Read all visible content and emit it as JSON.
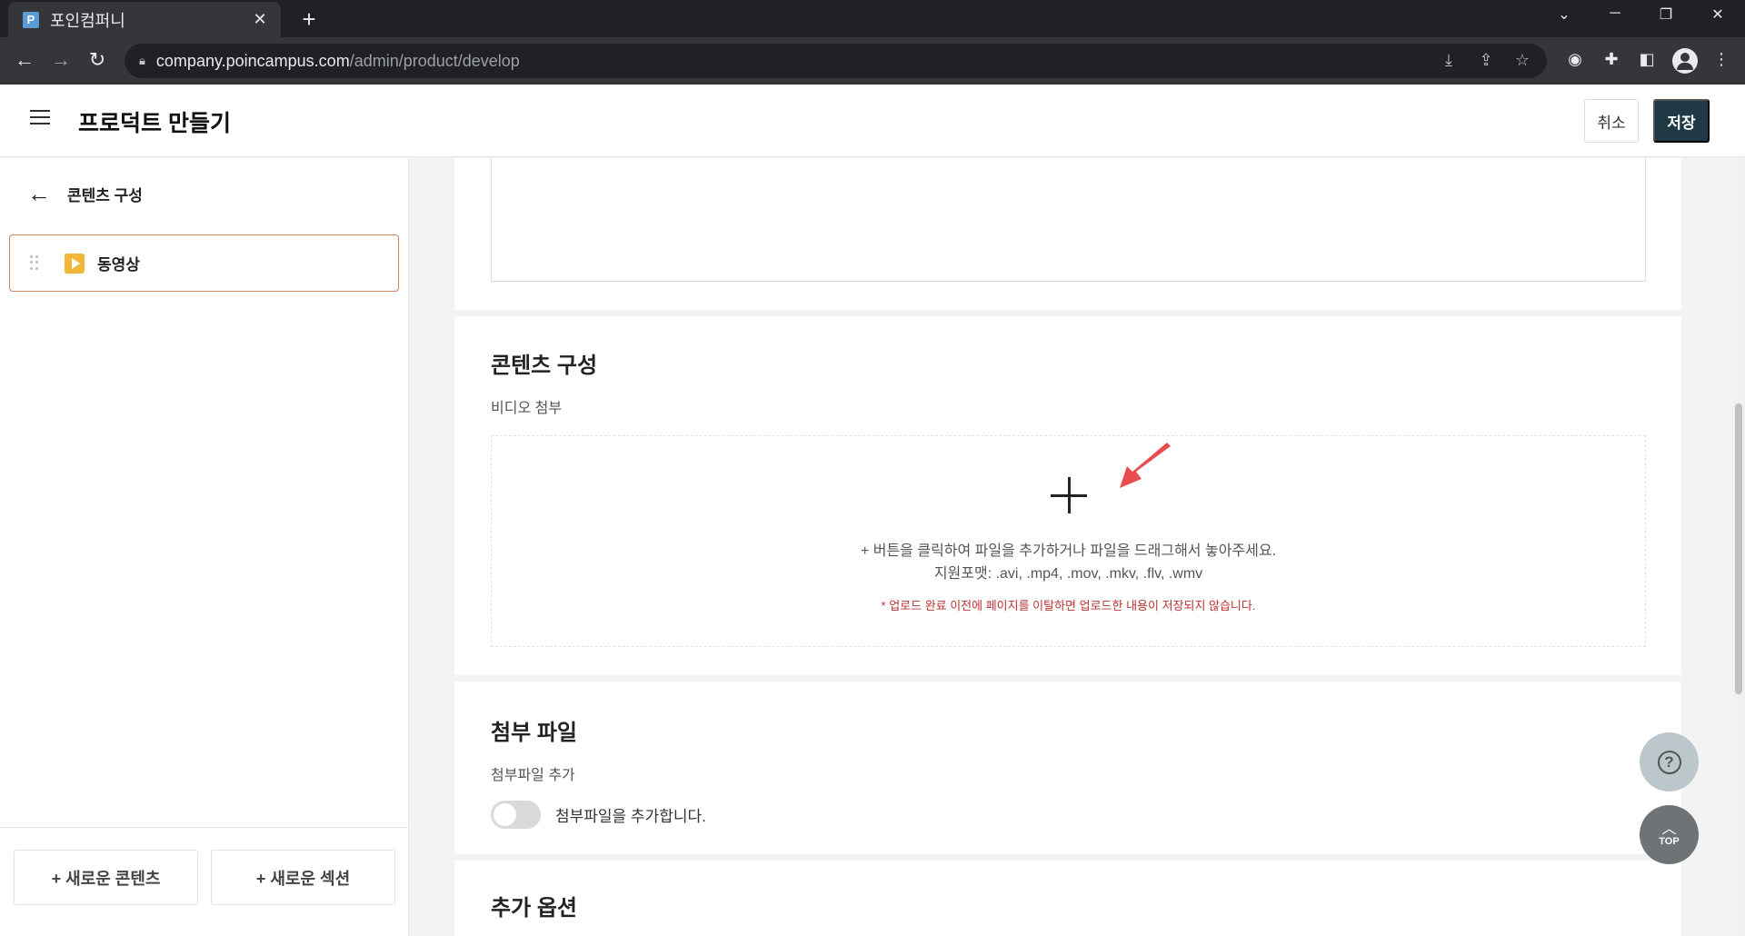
{
  "browser": {
    "tab_title": "포인컴퍼니",
    "favicon_letter": "P",
    "url_host": "company.poincampus.com",
    "url_path": "/admin/product/develop"
  },
  "header": {
    "title": "프로덕트 만들기",
    "cancel_label": "취소",
    "save_label": "저장"
  },
  "sidebar": {
    "back_label": "콘텐츠 구성",
    "items": [
      {
        "label": "동영상",
        "icon": "video-icon"
      }
    ],
    "new_content_label": "+ 새로운 콘텐츠",
    "new_section_label": "+ 새로운 섹션"
  },
  "content_section": {
    "title": "콘텐츠 구성",
    "subtitle": "비디오 첨부",
    "upload_instruction": "+ 버튼을 클릭하여 파일을 추가하거나 파일을 드래그해서 놓아주세요.",
    "supported_formats": "지원포맷: .avi, .mp4, .mov, .mkv, .flv, .wmv",
    "warning": "* 업로드 완료 이전에 페이지를 이탈하면 업로드한 내용이 저장되지 않습니다."
  },
  "attachment_section": {
    "title": "첨부 파일",
    "subtitle": "첨부파일 추가",
    "toggle_label": "첨부파일을 추가합니다.",
    "toggle_on": false
  },
  "options_section": {
    "title": "추가 옵션"
  },
  "floating": {
    "help_glyph": "?",
    "top_label": "TOP"
  },
  "colors": {
    "save_button": "#1f3a44",
    "accent_border": "#d28467",
    "video_icon": "#f2b737",
    "warning_text": "#b33333",
    "arrow": "#e84c4c"
  }
}
